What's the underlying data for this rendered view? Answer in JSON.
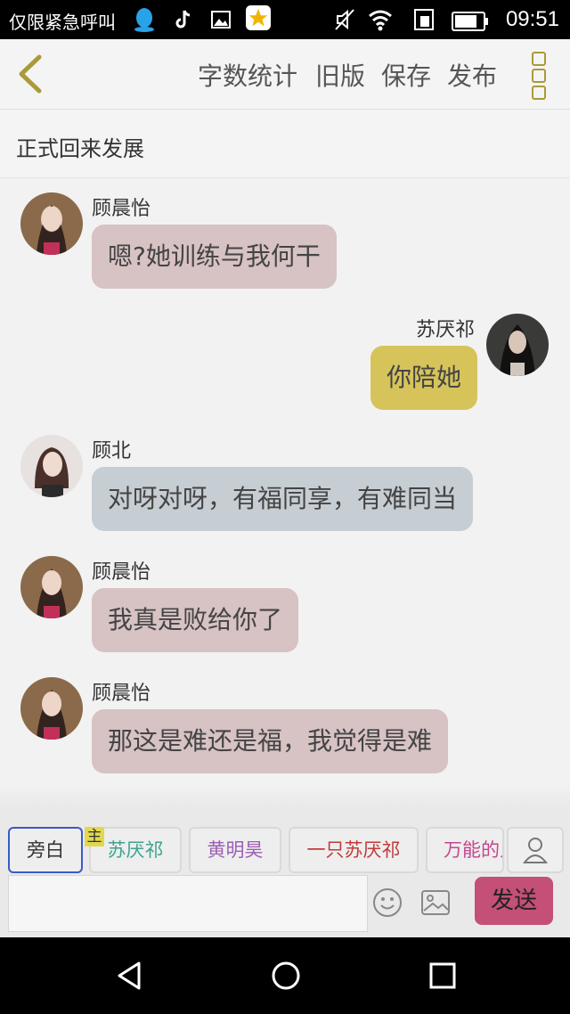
{
  "status_bar": {
    "emergency_text": "仅限紧急呼叫",
    "time": "09:51",
    "icons": [
      "qq-icon",
      "tiktok-icon",
      "gallery-icon",
      "star-app-icon",
      "mute-icon",
      "wifi-icon",
      "sim-icon",
      "battery-icon"
    ]
  },
  "header": {
    "menu": [
      "字数统计",
      "旧版",
      "保存",
      "发布"
    ]
  },
  "chapter_title": "正式回来发展",
  "messages": [
    {
      "sender": "顾晨怡",
      "text": "嗯?她训练与我何干",
      "side": "left"
    },
    {
      "sender": "苏厌祁",
      "text": "你陪她",
      "side": "right"
    },
    {
      "sender": "顾北",
      "text": "对呀对呀，有福同享，有难同当",
      "side": "left"
    },
    {
      "sender": "顾晨怡",
      "text": "我真是败给你了",
      "side": "left"
    },
    {
      "sender": "顾晨怡",
      "text": "那这是难还是福，我觉得是难",
      "side": "left"
    }
  ],
  "roles": [
    {
      "label": "旁白",
      "color": "#555555"
    },
    {
      "label": "苏厌祁",
      "color": "#3fa390"
    },
    {
      "label": "黄明昊",
      "color": "#9b5fb3"
    },
    {
      "label": "一只苏厌祁",
      "color": "#c23a3a"
    },
    {
      "label": "万能的人",
      "color": "#c2478c"
    }
  ],
  "main_badge": "主",
  "input": {
    "placeholder": ""
  },
  "send_label": "发送",
  "colors": {
    "accent": "#c44f77",
    "role_active_border": "#3b59c8",
    "bubble_pink": "#d7c2c4",
    "bubble_yellow": "#d6c45a",
    "bubble_grayblue": "#c6cdd3"
  }
}
